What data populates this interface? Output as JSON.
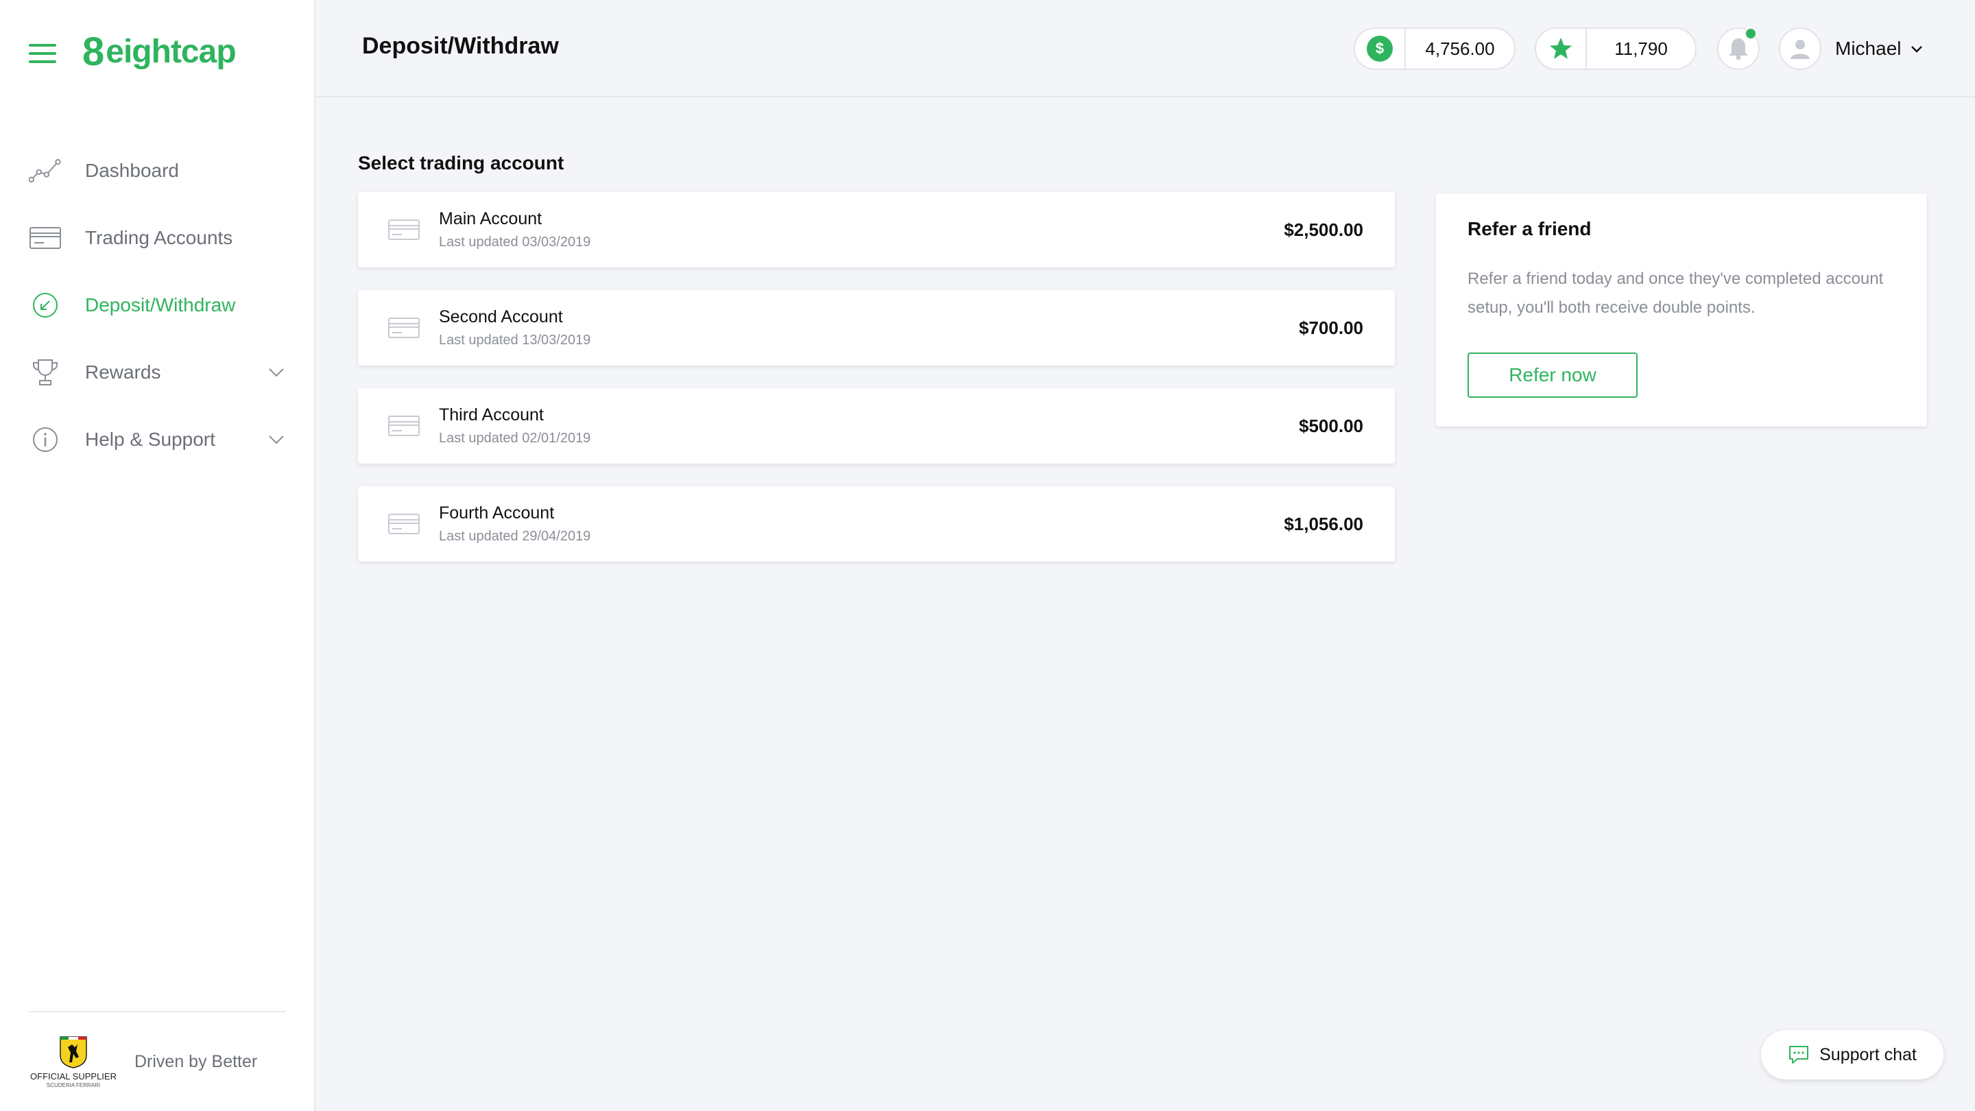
{
  "brand": {
    "logo_mark": "8",
    "logo_text": "eightcap",
    "accent": "#2fb45e"
  },
  "sidebar": {
    "items": [
      {
        "label": "Dashboard",
        "icon": "chart-line-icon",
        "active": false
      },
      {
        "label": "Trading Accounts",
        "icon": "card-icon",
        "active": false
      },
      {
        "label": "Deposit/Withdraw",
        "icon": "transfer-icon",
        "active": true
      },
      {
        "label": "Rewards",
        "icon": "trophy-icon",
        "active": false,
        "expandable": true
      },
      {
        "label": "Help & Support",
        "icon": "info-icon",
        "active": false,
        "expandable": true
      }
    ],
    "footer": {
      "supplier_line1": "OFFICIAL SUPPLIER",
      "supplier_line2": "SCUDERIA FERRARI",
      "tagline": "Driven by Better"
    }
  },
  "header": {
    "title": "Deposit/Withdraw",
    "balance": "4,756.00",
    "points": "11,790",
    "user_name": "Michael",
    "has_notification": true
  },
  "main": {
    "section_title": "Select trading account",
    "accounts": [
      {
        "name": "Main Account",
        "updated": "Last updated 03/03/2019",
        "amount": "$2,500.00"
      },
      {
        "name": "Second Account",
        "updated": "Last updated 13/03/2019",
        "amount": "$700.00"
      },
      {
        "name": "Third Account",
        "updated": "Last updated 02/01/2019",
        "amount": "$500.00"
      },
      {
        "name": "Fourth Account",
        "updated": "Last updated 29/04/2019",
        "amount": "$1,056.00"
      }
    ]
  },
  "refer": {
    "title": "Refer a friend",
    "body": "Refer a friend today and once they've completed account setup, you'll both receive double points.",
    "button": "Refer now"
  },
  "support_chat": {
    "label": "Support chat"
  }
}
